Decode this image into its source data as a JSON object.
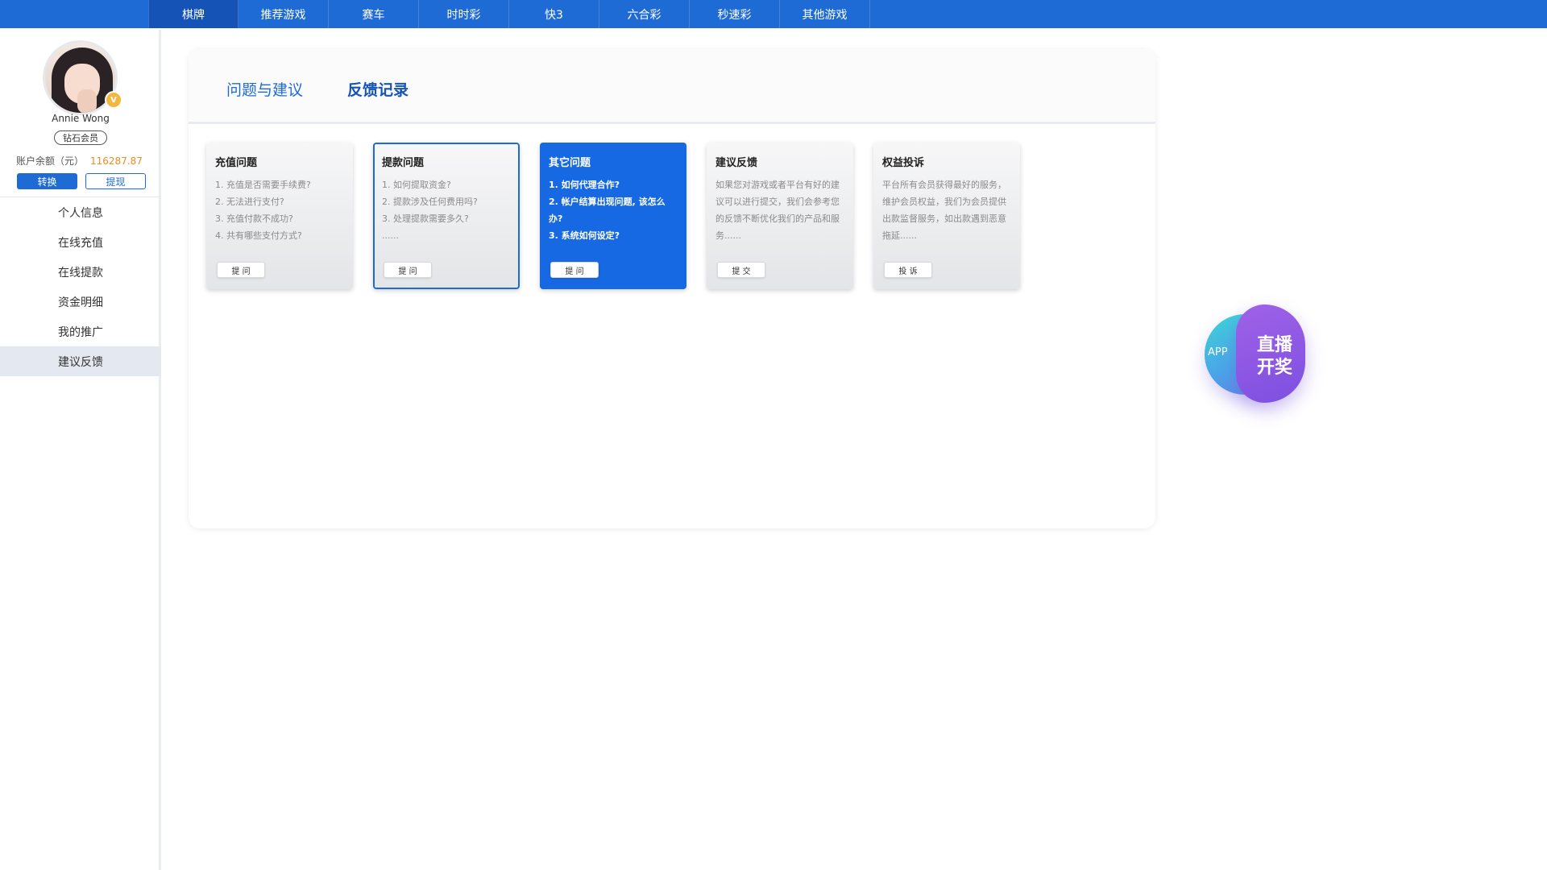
{
  "topnav": {
    "tabs": [
      {
        "label": "棋牌",
        "active": true
      },
      {
        "label": "推荐游戏",
        "active": false
      },
      {
        "label": "赛车",
        "active": false
      },
      {
        "label": "时时彩",
        "active": false
      },
      {
        "label": "快3",
        "active": false
      },
      {
        "label": "六合彩",
        "active": false
      },
      {
        "label": "秒速彩",
        "active": false
      },
      {
        "label": "其他游戏",
        "active": false
      }
    ]
  },
  "sidebar": {
    "username": "Annie Wong",
    "vip_badge": "V",
    "member_level": "钻石会员",
    "balance_label": "账户余额（元）",
    "balance_value": "116287.87",
    "transfer_label": "转换",
    "withdraw_label": "提现",
    "menu": [
      {
        "label": "个人信息",
        "active": false
      },
      {
        "label": "在线充值",
        "active": false
      },
      {
        "label": "在线提款",
        "active": false
      },
      {
        "label": "资金明细",
        "active": false
      },
      {
        "label": "我的推广",
        "active": false
      },
      {
        "label": "建议反馈",
        "active": true
      }
    ]
  },
  "panel": {
    "tabs": [
      "问题与建议",
      "反馈记录"
    ],
    "cards": [
      {
        "title": "充值问题",
        "lines": [
          "1. 充值是否需要手续费?",
          "2. 无法进行支付?",
          "3. 充值付款不成功?",
          "4. 共有哪些支付方式?"
        ],
        "button": "提 问"
      },
      {
        "title": "提款问题",
        "lines": [
          "1. 如何提取资金?",
          "2. 提款涉及任何费用吗?",
          "3. 处理提款需要多久?",
          "......"
        ],
        "button": "提 问"
      },
      {
        "title": "其它问题",
        "lines": [
          "1. 如何代理合作?",
          "2. 帐户结算出现问题, 该怎么办?",
          "3. 系统如何设定?"
        ],
        "button": "提 问"
      },
      {
        "title": "建议反馈",
        "text": "如果您对游戏或者平台有好的建议可以进行提交，我们会参考您的反馈不断优化我们的产品和服务......",
        "button": "提 交"
      },
      {
        "title": "权益投诉",
        "text": "平台所有会员获得最好的服务，维护会员权益，我们为会员提供出款监督服务，如出款遇到恶意拖延......",
        "button": "投 诉"
      }
    ]
  },
  "live_float": {
    "app_label": "APP",
    "line1": "直播",
    "line2": "开奖"
  },
  "colors": {
    "primary": "#1f6bd6",
    "balance": "#f08a24",
    "card_active": "#1668e3"
  }
}
